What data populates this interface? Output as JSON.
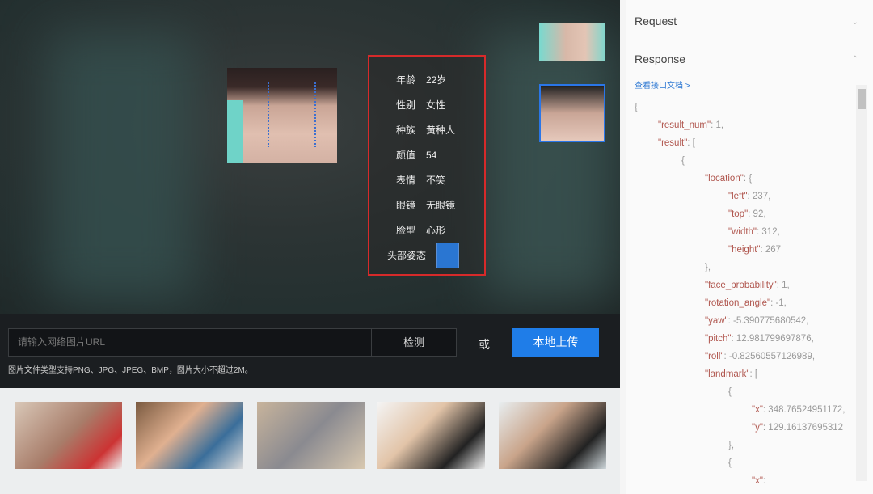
{
  "face_info": [
    {
      "label": "年龄",
      "value": "22岁"
    },
    {
      "label": "性别",
      "value": "女性"
    },
    {
      "label": "种族",
      "value": "黄种人"
    },
    {
      "label": "颜值",
      "value": "54"
    },
    {
      "label": "表情",
      "value": "不笑"
    },
    {
      "label": "眼镜",
      "value": "无眼镜"
    },
    {
      "label": "脸型",
      "value": "心形"
    }
  ],
  "head_pose_label": "头部姿态",
  "controls": {
    "url_placeholder": "请输入网络图片URL",
    "detect": "检测",
    "or": "或",
    "upload": "本地上传",
    "hint": "图片文件类型支持PNG、JPG、JPEG、BMP，图片大小不超过2M。"
  },
  "panel": {
    "request": "Request",
    "response": "Response",
    "doc_link": "查看接口文档 >"
  },
  "json_lines": [
    {
      "i": 0,
      "t": "{"
    },
    {
      "i": 1,
      "k": "\"result_num\"",
      "v": ": 1,"
    },
    {
      "i": 1,
      "k": "\"result\"",
      "v": ": ["
    },
    {
      "i": 2,
      "t": "{"
    },
    {
      "i": 3,
      "k": "\"location\"",
      "v": ": {"
    },
    {
      "i": 4,
      "k": "\"left\"",
      "v": ": 237,"
    },
    {
      "i": 4,
      "k": "\"top\"",
      "v": ": 92,"
    },
    {
      "i": 4,
      "k": "\"width\"",
      "v": ": 312,"
    },
    {
      "i": 4,
      "k": "\"height\"",
      "v": ": 267"
    },
    {
      "i": 3,
      "t": "},"
    },
    {
      "i": 3,
      "k": "\"face_probability\"",
      "v": ": 1,"
    },
    {
      "i": 3,
      "k": "\"rotation_angle\"",
      "v": ": -1,"
    },
    {
      "i": 3,
      "k": "\"yaw\"",
      "v": ": -5.390775680542,"
    },
    {
      "i": 3,
      "k": "\"pitch\"",
      "v": ": 12.981799697876,"
    },
    {
      "i": 3,
      "k": "\"roll\"",
      "v": ": -0.82560557126989,"
    },
    {
      "i": 3,
      "k": "\"landmark\"",
      "v": ": ["
    },
    {
      "i": 4,
      "t": "{"
    },
    {
      "i": 5,
      "k": "\"x\"",
      "v": ": 348.76524951172,"
    },
    {
      "i": 5,
      "k": "\"y\"",
      "v": ": 129.16137695312"
    },
    {
      "i": 4,
      "t": "},"
    },
    {
      "i": 4,
      "t": "{"
    },
    {
      "i": 5,
      "k": "\"x\"",
      "v": ":"
    }
  ],
  "colors": {
    "accent": "#1f7de8",
    "highlight_box": "#d62a2a"
  }
}
